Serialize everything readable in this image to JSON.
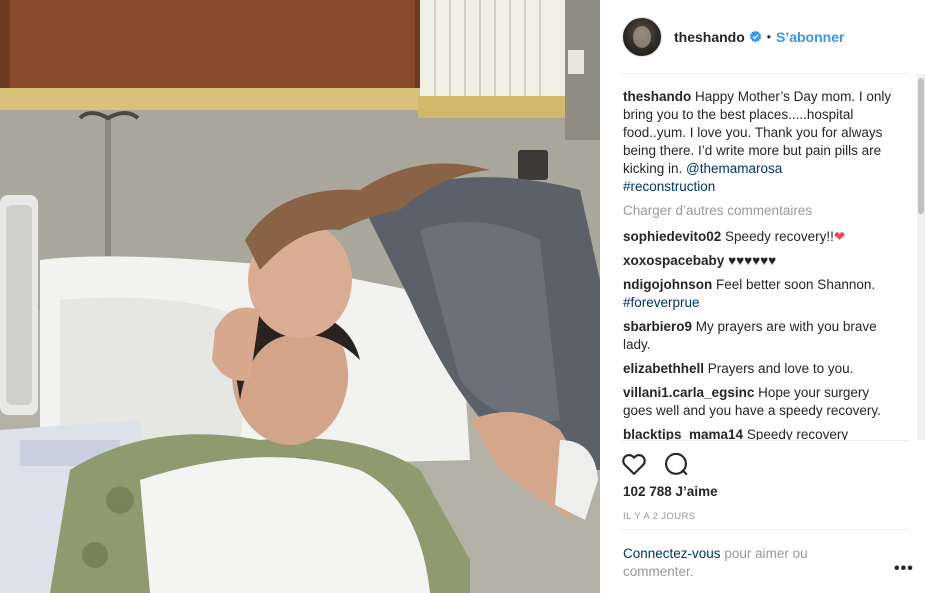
{
  "post": {
    "username": "theshando",
    "follow_label": "S’abonner",
    "separator": "•"
  },
  "comments": [
    {
      "user": "theshando",
      "parts": [
        "Happy Mother’s Day mom. I only bring you to the best places.....hospital food..yum. I love you. Thank you for always being there. I’d write more but pain pills are kicking in. "
      ],
      "mention": "@themamarosa",
      "hashtag": "#reconstruction"
    },
    {
      "user": "sophiedevito02",
      "text": "Speedy recovery!!",
      "emoji": "❤"
    },
    {
      "user": "xoxospacebaby",
      "text": "♥♥♥♥♥♥"
    },
    {
      "user": "ndigojohnson",
      "text": "Feel better soon Shannon.",
      "hashtag": "#foreverprue"
    },
    {
      "user": "sbarbiero9",
      "text": "My prayers are with you brave lady."
    },
    {
      "user": "elizabethhell",
      "text": "Prayers and love to you."
    },
    {
      "user": "villani1.carla_egsinc",
      "text": "Hope your surgery goes well and you have a speedy recovery."
    },
    {
      "user": "blacktips_mama14",
      "text": "Speedy recovery"
    }
  ],
  "load_more": "Charger d’autres commentaires",
  "likes": "102 788 J’aime",
  "timestamp": "IL Y A 2 JOURS",
  "login": {
    "link": "Connectez-vous",
    "rest": " pour aimer ou commenter."
  },
  "more_options": "•••",
  "icons": {
    "verified": "verified-badge-icon",
    "like": "heart-outline-icon",
    "comment": "speech-bubble-icon"
  },
  "colors": {
    "link_blue": "#3897f0",
    "hashtag_blue": "#003569",
    "muted": "#999999",
    "heart_red": "#ed4956"
  }
}
